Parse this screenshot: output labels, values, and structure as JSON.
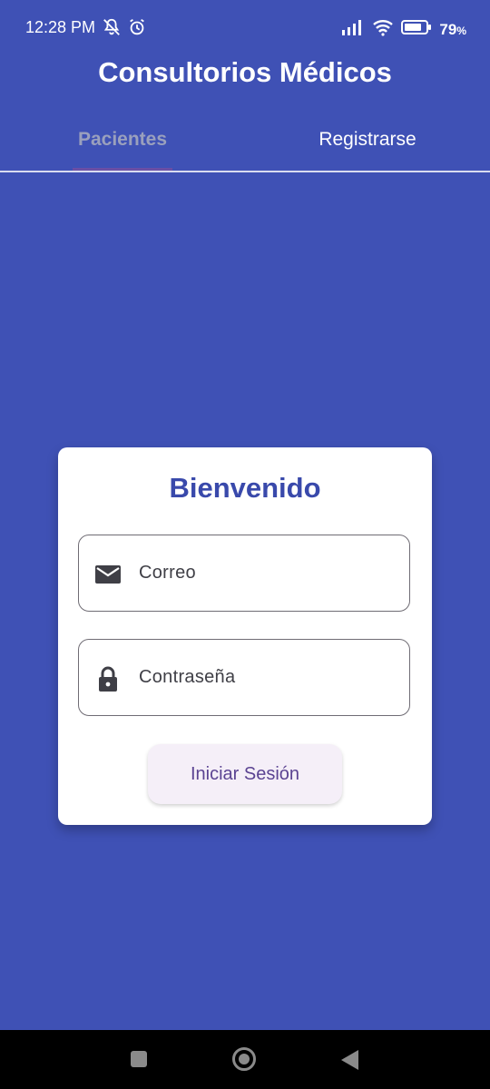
{
  "status_bar": {
    "time": "12:28 PM",
    "battery": "79",
    "battery_unit": "%",
    "icons": [
      "mute-icon",
      "alarm-icon",
      "signal-icon",
      "wifi-icon",
      "battery-icon"
    ]
  },
  "app": {
    "title": "Consultorios Médicos",
    "background_color": "#3f51b5"
  },
  "tabs": [
    {
      "label": "Pacientes",
      "selected": true
    },
    {
      "label": "Registrarse",
      "selected": false
    }
  ],
  "login_card": {
    "title": "Bienvenido",
    "email": {
      "icon": "mail-icon",
      "placeholder": "Correo"
    },
    "password": {
      "icon": "lock-icon",
      "placeholder": "Contraseña"
    },
    "login_button": "Iniciar Sesión"
  },
  "nav_bar": {
    "icons": [
      "recent-apps-icon",
      "home-icon",
      "back-icon"
    ]
  }
}
